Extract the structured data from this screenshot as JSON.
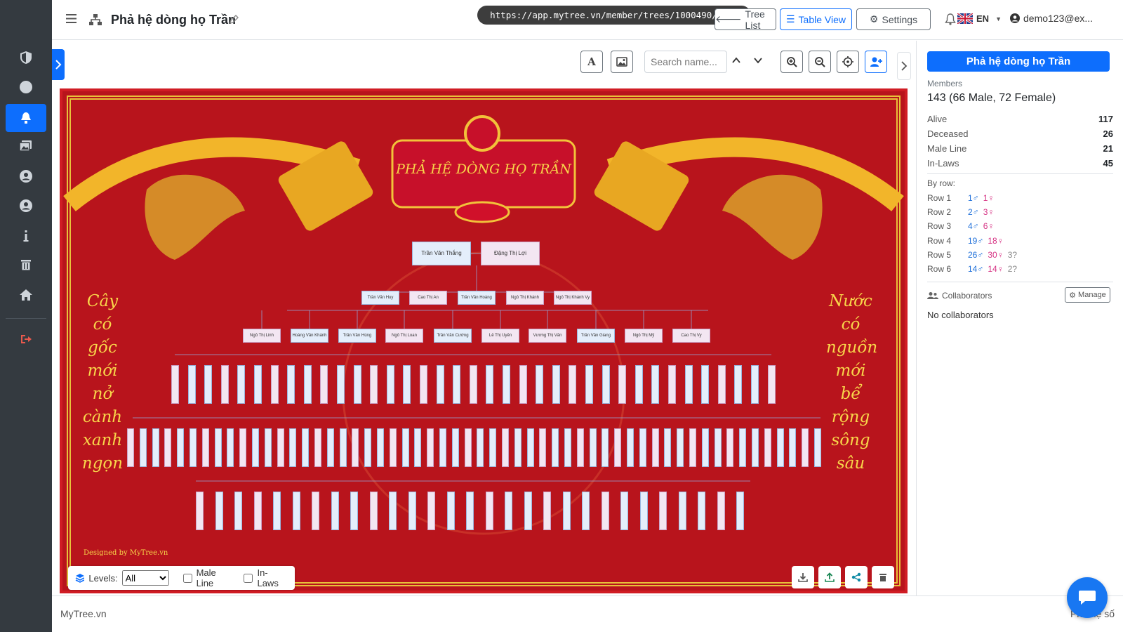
{
  "url": "https://app.mytree.vn/member/trees/1000490/view",
  "header": {
    "title": "Phả hệ dòng họ Trần",
    "tree_list": "Tree List",
    "table_view": "Table View",
    "settings": "Settings",
    "lang": "EN",
    "user": "demo123@ex..."
  },
  "toolbar": {
    "search_placeholder": "Search name..."
  },
  "tree": {
    "banner_title": "PHẢ HỆ DÒNG HỌ TRẦN",
    "credit": "Designed by MyTree.vn",
    "poem_left": [
      "Cây",
      "có",
      "gốc",
      "mới",
      "nở",
      "cành",
      "xanh",
      "ngọn"
    ],
    "poem_right": [
      "Nước",
      "có",
      "nguồn",
      "mới",
      "bể",
      "rộng",
      "sông",
      "sâu"
    ],
    "row1": [
      {
        "name": "Trần Văn Thắng",
        "g": "m"
      },
      {
        "name": "Đặng Thị Lợi",
        "g": "f"
      }
    ],
    "row2": [
      {
        "name": "Trần Văn Huy",
        "g": "m"
      },
      {
        "name": "Cao Thị An",
        "g": "f"
      },
      {
        "name": "Trần Văn Hoàng",
        "g": "m"
      },
      {
        "name": "Ngô Thị Khánh",
        "g": "f"
      },
      {
        "name": "Ngô Thị Khánh Vy",
        "g": "f"
      }
    ],
    "row3": [
      {
        "name": "Ngô Thị Linh",
        "g": "f"
      },
      {
        "name": "Hoàng Văn Khánh",
        "g": "m"
      },
      {
        "name": "Trần Văn Hùng",
        "g": "m"
      },
      {
        "name": "Ngô Thị Loan",
        "g": "f"
      },
      {
        "name": "Trần Văn Cường",
        "g": "m"
      },
      {
        "name": "Lê Thị Uyên",
        "g": "f"
      },
      {
        "name": "Vương Thị Vân",
        "g": "f"
      },
      {
        "name": "Trần Văn Giang",
        "g": "m"
      },
      {
        "name": "Ngô Thị Mỹ",
        "g": "f"
      },
      {
        "name": "Cao Thị Vy",
        "g": "f"
      }
    ]
  },
  "bottom_bar": {
    "levels_label": "Levels:",
    "levels_value": "All",
    "male_line": "Male Line",
    "in_laws": "In-Laws"
  },
  "panel": {
    "title": "Phả hệ dòng họ Trần",
    "members_label": "Members",
    "members_value": "143 (66 Male, 72 Female)",
    "stats": [
      {
        "label": "Alive",
        "value": "117"
      },
      {
        "label": "Deceased",
        "value": "26"
      },
      {
        "label": "Male Line",
        "value": "21"
      },
      {
        "label": "In-Laws",
        "value": "45"
      }
    ],
    "by_row_label": "By row:",
    "rows": [
      {
        "label": "Row 1",
        "male": "1♂",
        "female": "1♀",
        "unknown": ""
      },
      {
        "label": "Row 2",
        "male": "2♂",
        "female": "3♀",
        "unknown": ""
      },
      {
        "label": "Row 3",
        "male": "4♂",
        "female": "6♀",
        "unknown": ""
      },
      {
        "label": "Row 4",
        "male": "19♂",
        "female": "18♀",
        "unknown": ""
      },
      {
        "label": "Row 5",
        "male": "26♂",
        "female": "30♀",
        "unknown": "3?"
      },
      {
        "label": "Row 6",
        "male": "14♂",
        "female": "14♀",
        "unknown": "2?"
      }
    ],
    "collaborators_label": "Collaborators",
    "manage": "Manage",
    "no_collaborators": "No collaborators"
  },
  "footer": {
    "brand": "MyTree.vn",
    "right": "Phả hệ số"
  },
  "colors": {
    "primary": "#0d6efd",
    "sidebar": "#343a40",
    "tree_bg": "#b8141c",
    "poem": "#f8d64a",
    "male": "#1e6fd9",
    "female": "#d63384"
  }
}
